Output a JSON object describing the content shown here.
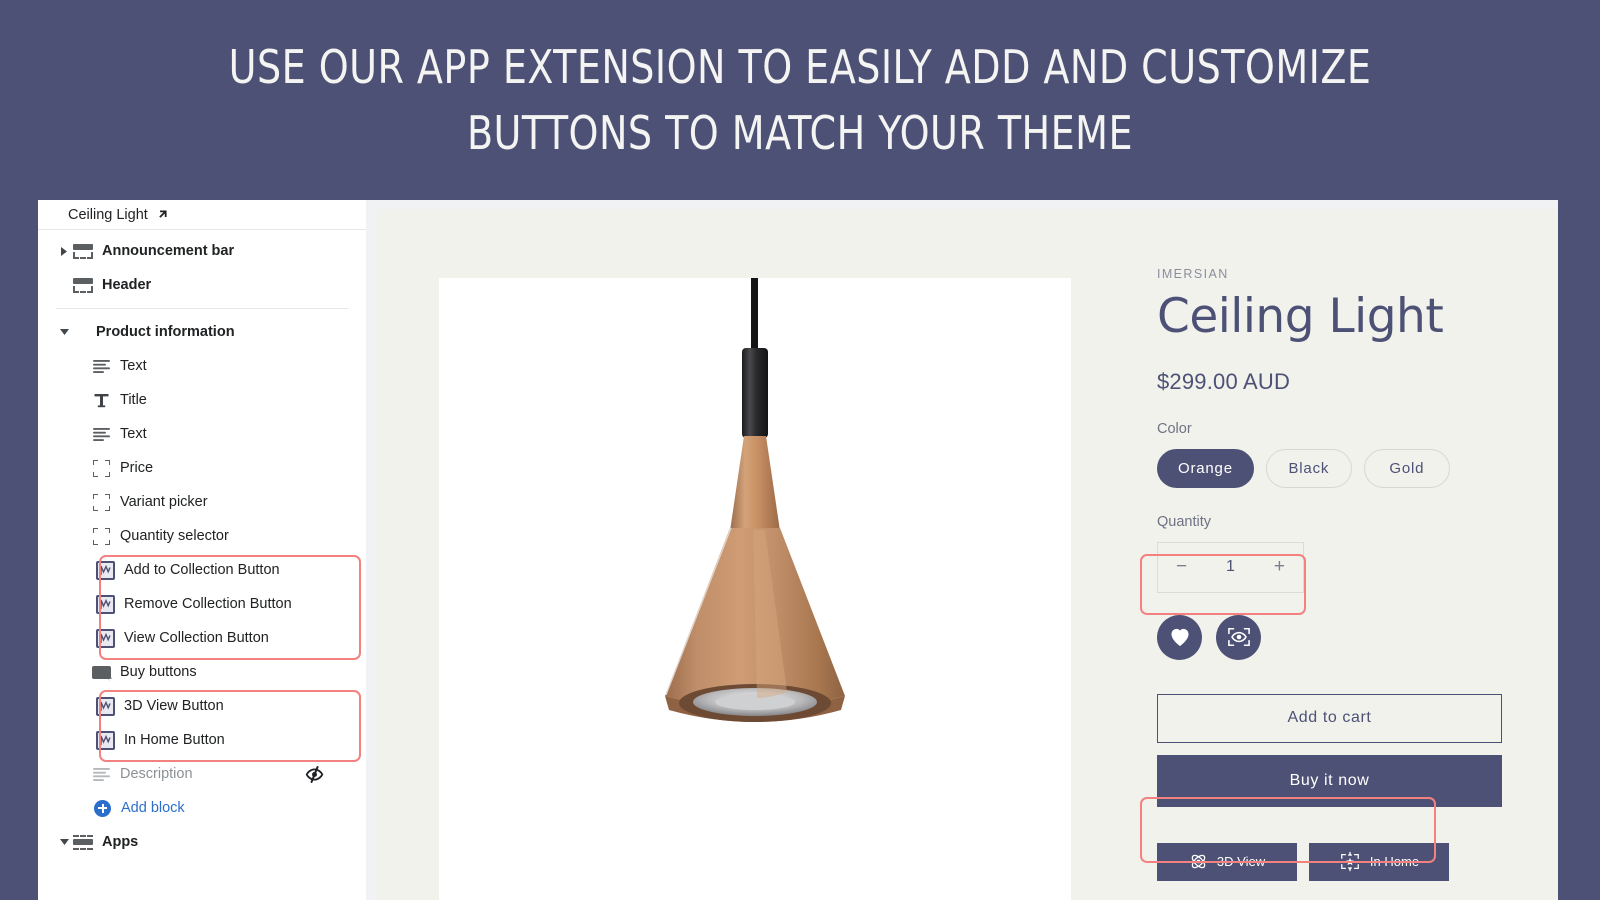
{
  "banner": {
    "line1": "USE OUR APP EXTENSION TO EASILY ADD AND CUSTOMIZE",
    "line2": "BUTTONS TO MATCH YOUR THEME",
    "bg_color": "#4d5175",
    "text_color": "#f4f4f2"
  },
  "sidebar": {
    "header": {
      "label": "Ceiling Light",
      "icon": "external-link-icon"
    },
    "items": [
      {
        "label": "Announcement bar",
        "icon": "section-icon",
        "caret": "collapsed",
        "kind": "section"
      },
      {
        "label": "Header",
        "icon": "section-icon",
        "caret": "none",
        "kind": "section"
      },
      {
        "label": "Product information",
        "icon": "none",
        "caret": "expanded",
        "kind": "group"
      },
      {
        "label": "Text",
        "icon": "text-icon",
        "kind": "block"
      },
      {
        "label": "Title",
        "icon": "title-icon",
        "kind": "block"
      },
      {
        "label": "Text",
        "icon": "text-icon",
        "kind": "block"
      },
      {
        "label": "Price",
        "icon": "placeholder-icon",
        "kind": "block"
      },
      {
        "label": "Variant picker",
        "icon": "placeholder-icon",
        "kind": "block"
      },
      {
        "label": "Quantity selector",
        "icon": "placeholder-icon",
        "kind": "block"
      },
      {
        "label": "Add to Collection Button",
        "icon": "app-block-icon",
        "kind": "app-block"
      },
      {
        "label": "Remove Collection Button",
        "icon": "app-block-icon",
        "kind": "app-block"
      },
      {
        "label": "View Collection Button",
        "icon": "app-block-icon",
        "kind": "app-block"
      },
      {
        "label": "Buy buttons",
        "icon": "buy-buttons-icon",
        "kind": "block"
      },
      {
        "label": "3D View Button",
        "icon": "app-block-icon",
        "kind": "app-block"
      },
      {
        "label": "In Home Button",
        "icon": "app-block-icon",
        "kind": "app-block"
      },
      {
        "label": "Description",
        "icon": "text-icon",
        "kind": "block",
        "hidden": true,
        "hidden_icon": "eye-off-icon"
      }
    ],
    "add_block": {
      "label": "Add block",
      "icon": "plus-circle-icon"
    },
    "apps": {
      "label": "Apps",
      "icon": "apps-icon",
      "caret": "expanded"
    }
  },
  "annotations": {
    "color": "#f3817f",
    "boxes": [
      {
        "name": "collection-buttons-highlight"
      },
      {
        "name": "ar-buttons-highlight"
      },
      {
        "name": "circle-buttons-highlight"
      },
      {
        "name": "ar-preview-highlight"
      }
    ]
  },
  "product": {
    "vendor": "IMERSIAN",
    "title": "Ceiling Light",
    "price": "$299.00 AUD",
    "color_label": "Color",
    "color_options": [
      {
        "label": "Orange",
        "selected": true
      },
      {
        "label": "Black",
        "selected": false
      },
      {
        "label": "Gold",
        "selected": false
      }
    ],
    "quantity_label": "Quantity",
    "quantity": {
      "minus": "−",
      "value": "1",
      "plus": "+"
    },
    "icon_buttons": [
      {
        "name": "wishlist-button",
        "icon": "heart-icon"
      },
      {
        "name": "view-collection-button",
        "icon": "eye-scan-icon"
      }
    ],
    "add_to_cart": "Add to cart",
    "buy_it_now": "Buy it now",
    "ar_buttons": [
      {
        "label": "3D View",
        "icon": "orbit-icon"
      },
      {
        "label": "In Home",
        "icon": "ar-place-icon"
      }
    ],
    "image_alt": "pendant ceiling light"
  },
  "colors": {
    "accent": "#4d5175",
    "page_bg": "#f2f2ec",
    "editor_bg": "#f1f2f4",
    "sidebar_bg": "#ffffff",
    "link": "#2c6ecb",
    "annotation": "#f3817f"
  }
}
